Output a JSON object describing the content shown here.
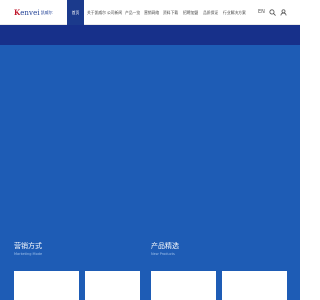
{
  "header": {
    "logo": {
      "brand": "Kenvei",
      "brand_initial": "K",
      "brand_rest": "envei",
      "subtitle": "凯威尔"
    },
    "nav": [
      {
        "label": "首页",
        "active": true
      },
      {
        "label": "关于凯威尔"
      },
      {
        "label": "公司新闻"
      },
      {
        "label": "产品一览"
      },
      {
        "label": "营销网络"
      },
      {
        "label": "资料下载"
      },
      {
        "label": "招聘加盟"
      },
      {
        "label": "品质保证"
      },
      {
        "label": "行业解决方案"
      }
    ],
    "search_icon": "search-icon",
    "user_icon": "user-icon",
    "language": "EN"
  },
  "sections": {
    "marketing": {
      "title": "营销方式",
      "subtitle": "Marketing Mode"
    },
    "products": {
      "title": "产品精选",
      "subtitle": "New Products"
    }
  },
  "colors": {
    "primary": "#1b3a8c",
    "hero": "#17308a",
    "main_bg": "#1e5cb5",
    "logo_red": "#c0182c"
  }
}
